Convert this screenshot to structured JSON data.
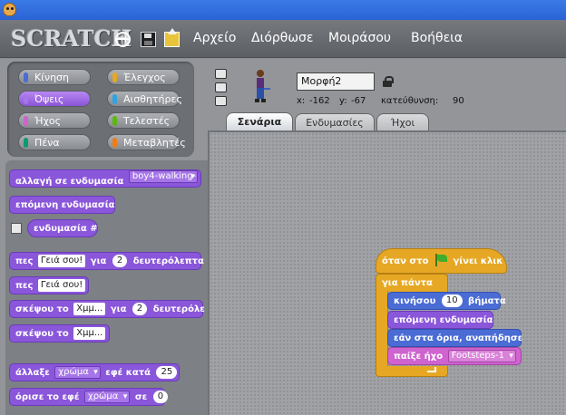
{
  "menubar": {
    "logo": "SCRATCH",
    "items": [
      "Αρχείο",
      "Διόρθωσε",
      "Μοιράσου",
      "Βοήθεια"
    ],
    "icons": [
      "globe-icon",
      "save-icon",
      "share-icon"
    ]
  },
  "palette": {
    "categories": [
      {
        "label": "Κίνηση",
        "color": "#4a6cd4"
      },
      {
        "label": "Έλεγχος",
        "color": "#e6a824"
      },
      {
        "label": "Όψεις",
        "color": "#8a56da",
        "active": true
      },
      {
        "label": "Αισθητήρες",
        "color": "#2ca5e2"
      },
      {
        "label": "Ήχος",
        "color": "#cf63cf"
      },
      {
        "label": "Τελεστές",
        "color": "#5cb712"
      },
      {
        "label": "Πένα",
        "color": "#0e9a6c"
      },
      {
        "label": "Μεταβλητές",
        "color": "#ee7d16"
      }
    ],
    "blocks": {
      "switch_costume": {
        "label": "αλλαγή σε ενδυμασία",
        "value": "boy4-walking-"
      },
      "next_costume": "επόμενη ενδυμασία",
      "costume_num": "ενδυμασία #",
      "say_for": {
        "label": "πες",
        "text": "Γειά σου!",
        "mid": "για",
        "secs": "2",
        "end": "δευτερόλεπτα"
      },
      "say": {
        "label": "πες",
        "text": "Γειά σου!"
      },
      "think_for": {
        "label": "σκέψου το",
        "text": "Χμμ...",
        "mid": "για",
        "secs": "2",
        "end": "δευτερόλε"
      },
      "think": {
        "label": "σκέψου το",
        "text": "Χμμ..."
      },
      "change_effect": {
        "label": "άλλαξε",
        "effect": "χρώμα",
        "mid": "εφέ κατά",
        "value": "25"
      },
      "set_effect": {
        "label": "όρισε το εφέ",
        "effect": "χρώμα",
        "mid": "σε",
        "value": "0"
      }
    }
  },
  "sprite": {
    "name": "Μορφή2",
    "x_label": "x:",
    "x": "-162",
    "y_label": "y:",
    "y": "-67",
    "direction_label": "κατεύθυνση:",
    "direction": "90"
  },
  "tabs": [
    "Σενάρια",
    "Ενδυμασίες",
    "Ήχοι"
  ],
  "script": {
    "hat": {
      "pre": "όταν στο",
      "post": "γίνει κλικ"
    },
    "forever": "για πάντα",
    "move": {
      "label": "κινήσου",
      "value": "10",
      "end": "βήματα"
    },
    "next_costume": "επόμενη ενδυμασία",
    "bounce": "εάν στα όρια, αναπήδησε",
    "play_sound": {
      "label": "παίξε ήχο",
      "value": "Footsteps-1"
    }
  }
}
